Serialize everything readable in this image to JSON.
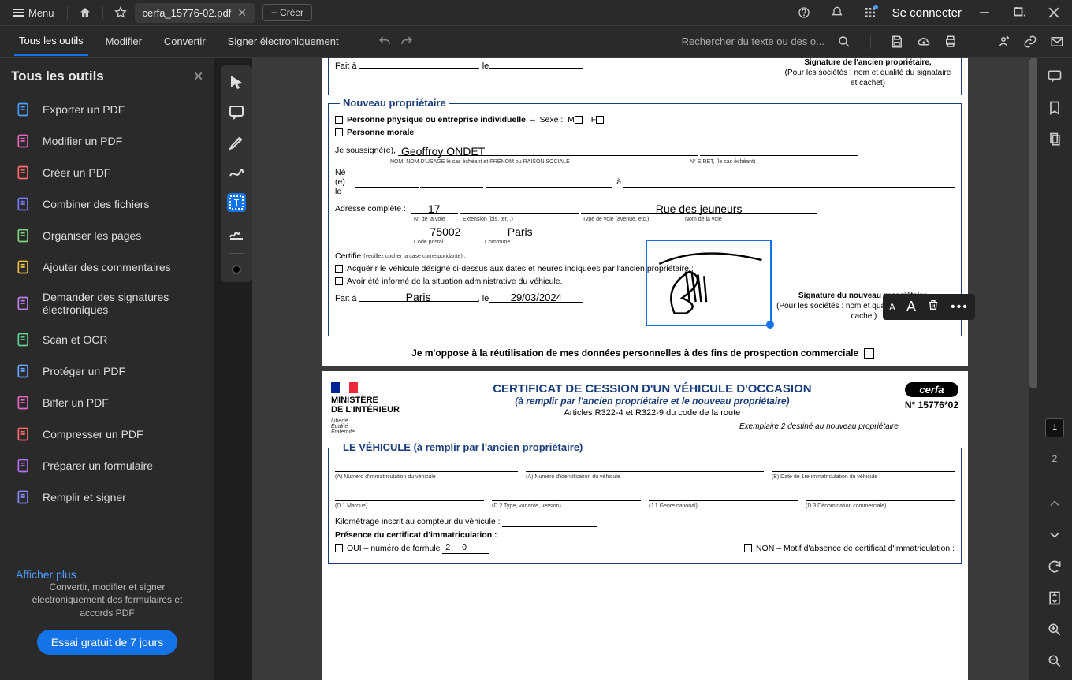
{
  "titlebar": {
    "menu": "Menu",
    "tab_title": "cerfa_15776-02.pdf",
    "create": "Créer",
    "signin": "Se connecter"
  },
  "toolbar": {
    "all_tools": "Tous les outils",
    "modify": "Modifier",
    "convert": "Convertir",
    "sign": "Signer électroniquement",
    "search_placeholder": "Rechercher du texte ou des o..."
  },
  "sidebar": {
    "title": "Tous les outils",
    "items": [
      {
        "label": "Exporter un PDF",
        "color": "#4b9fff"
      },
      {
        "label": "Modifier un PDF",
        "color": "#e668c2"
      },
      {
        "label": "Créer un PDF",
        "color": "#ff6b6b"
      },
      {
        "label": "Combiner des fichiers",
        "color": "#7b7bff"
      },
      {
        "label": "Organiser les pages",
        "color": "#7dd87d"
      },
      {
        "label": "Ajouter des commentaires",
        "color": "#f0c048"
      },
      {
        "label": "Demander des signatures électroniques",
        "color": "#c080f0"
      },
      {
        "label": "Scan et OCR",
        "color": "#60d090"
      },
      {
        "label": "Protéger un PDF",
        "color": "#6ba8ff"
      },
      {
        "label": "Biffer un PDF",
        "color": "#e668c2"
      },
      {
        "label": "Compresser un PDF",
        "color": "#ff6b6b"
      },
      {
        "label": "Préparer un formulaire",
        "color": "#b070f0"
      },
      {
        "label": "Remplir et signer",
        "color": "#8888ff"
      }
    ],
    "show_more": "Afficher plus",
    "promo": "Convertir, modifier et signer électroniquement des formulaires et accords PDF",
    "trial": "Essai gratuit de 7 jours"
  },
  "doc": {
    "fait_a": "Fait à",
    "le": "le",
    "sig_old": "Signature de l'ancien propriétaire,",
    "sig_sub": "(Pour les sociétés : nom et qualité du signataire et cachet)",
    "new_owner": "Nouveau propriétaire",
    "phys": "Personne physique ou entreprise individuelle",
    "sexe": "Sexe :",
    "M": "M",
    "F": "F",
    "morale": "Personne morale",
    "soussigne": "Je soussigné(e),",
    "name": "Geoffroy ONDET",
    "name_hint": "NOM, NOM D'USAGE le cas échéant et PRÉNOM ou RAISON SOCIALE",
    "siret": "N° SIRET, (le cas échéant)",
    "ne": "Né (e) le",
    "a": "à",
    "addr": "Adresse complète :",
    "street_no": "17",
    "street_name": "Rue des jeuneurs",
    "h1": "N° de la voie",
    "h2": "Extension (bis, ter, .)",
    "h3": "Type de voie (avenue, etc.)",
    "h4": "Nom de la voie",
    "postal": "75002",
    "city": "Paris",
    "h5": "Code postal",
    "h6": "Commune",
    "certif": "Certifie",
    "certif_hint": "(veuillez cocher la case correspondante) :",
    "opt1": "Acquérir le véhicule désigné ci-dessus aux dates et heures indiquées par l'ancien propriétaire ;",
    "opt2": "Avoir été informé de la situation administrative du véhicule.",
    "place": "Paris",
    "date": "29/03/2024",
    "sig_new": "Signature du nouveau propriétaire,",
    "oppose": "Je m'oppose à la réutilisation de mes données personnelles à des fins de prospection commerciale",
    "ministry1": "MINISTÈRE",
    "ministry2": "DE L'INTÉRIEUR",
    "motto": "Liberté\nÉgalité\nFraternité",
    "cert_title": "CERTIFICAT DE CESSION D'UN VÉHICULE D'OCCASION",
    "cert_sub": "(à remplir par l'ancien propriétaire et le nouveau propriétaire)",
    "articles": "Articles R322-4 et R322-9 du code de la route",
    "exemplaire": "Exemplaire 2 destiné au nouveau propriétaire",
    "cerfa": "cerfa",
    "cerfa_no": "N° 15776*02",
    "vehicle": "LE VÉHICULE (à remplir par l'ancien propriétaire)",
    "fA": "(A) Numéro d'immatriculation du véhicule",
    "fAbis": "(A) Numéro d'identification du véhicule",
    "fB": "(B) Date de 1re immatriculation du véhicule",
    "fD1": "(D.1 Marque)",
    "fD2": "(D.2 Type, variante, version)",
    "fJ1": "(J.1 Genre national)",
    "fD3": "(D.3 Dénomination commerciale)",
    "km": "Kilométrage inscrit au compteur du véhicule :",
    "presence": "Présence du certificat d'immatriculation :",
    "oui": "OUI – numéro de formule",
    "formule": "2  0",
    "non": "NON – Motif d'absence de certificat d'immatriculation :"
  },
  "pages": {
    "current": "1",
    "next": "2"
  }
}
